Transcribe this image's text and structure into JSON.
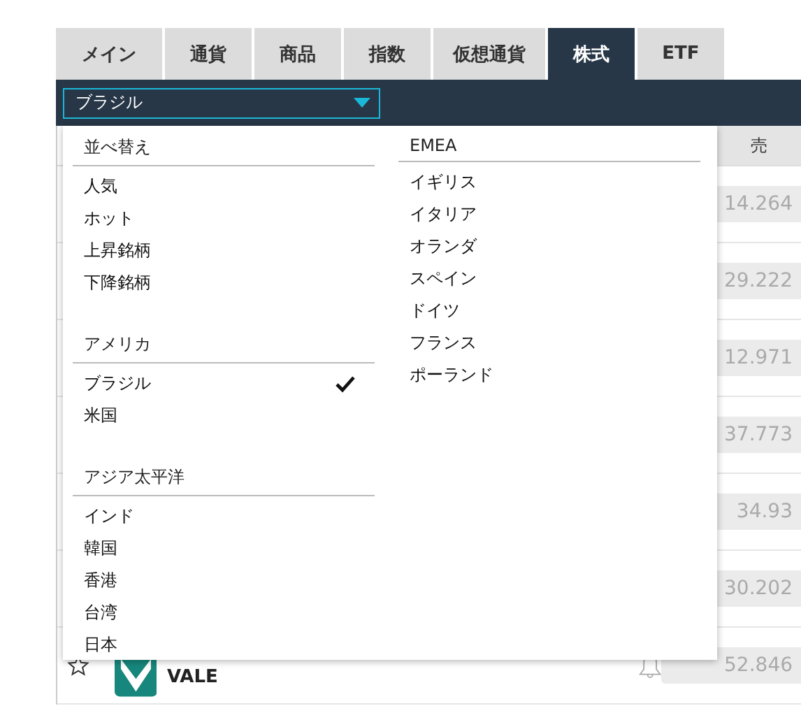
{
  "tabs": [
    {
      "label": "メイン",
      "selected": false
    },
    {
      "label": "通貨",
      "selected": false
    },
    {
      "label": "商品",
      "selected": false
    },
    {
      "label": "指数",
      "selected": false
    },
    {
      "label": "仮想通貨",
      "selected": false
    },
    {
      "label": "株式",
      "selected": true
    },
    {
      "label": "ETF",
      "selected": false
    }
  ],
  "region_select": {
    "value": "ブラジル"
  },
  "dropdown": {
    "columns": [
      {
        "groups": [
          {
            "heading": "並べ替え",
            "items": [
              {
                "label": "人気",
                "selected": false
              },
              {
                "label": "ホット",
                "selected": false
              },
              {
                "label": "上昇銘柄",
                "selected": false
              },
              {
                "label": "下降銘柄",
                "selected": false
              }
            ]
          },
          {
            "heading": "アメリカ",
            "items": [
              {
                "label": "ブラジル",
                "selected": true
              },
              {
                "label": "米国",
                "selected": false
              }
            ]
          },
          {
            "heading": "アジア太平洋",
            "items": [
              {
                "label": "インド",
                "selected": false
              },
              {
                "label": "韓国",
                "selected": false
              },
              {
                "label": "香港",
                "selected": false
              },
              {
                "label": "台湾",
                "selected": false
              },
              {
                "label": "日本",
                "selected": false
              }
            ]
          }
        ]
      },
      {
        "groups": [
          {
            "heading": "EMEA",
            "items": [
              {
                "label": "イギリス",
                "selected": false
              },
              {
                "label": "イタリア",
                "selected": false
              },
              {
                "label": "オランダ",
                "selected": false
              },
              {
                "label": "スペイン",
                "selected": false
              },
              {
                "label": "ドイツ",
                "selected": false
              },
              {
                "label": "フランス",
                "selected": false
              },
              {
                "label": "ポーランド",
                "selected": false
              }
            ]
          }
        ]
      }
    ]
  },
  "table": {
    "sell_header": "売",
    "rows": [
      {
        "sell": "14.264"
      },
      {
        "sell": "29.222"
      },
      {
        "sell": "12.971"
      },
      {
        "sell": "37.773"
      },
      {
        "sell": "34.93"
      },
      {
        "sell": "30.202"
      },
      {
        "name": "VALE",
        "starred": false,
        "sell": "52.846"
      }
    ]
  }
}
